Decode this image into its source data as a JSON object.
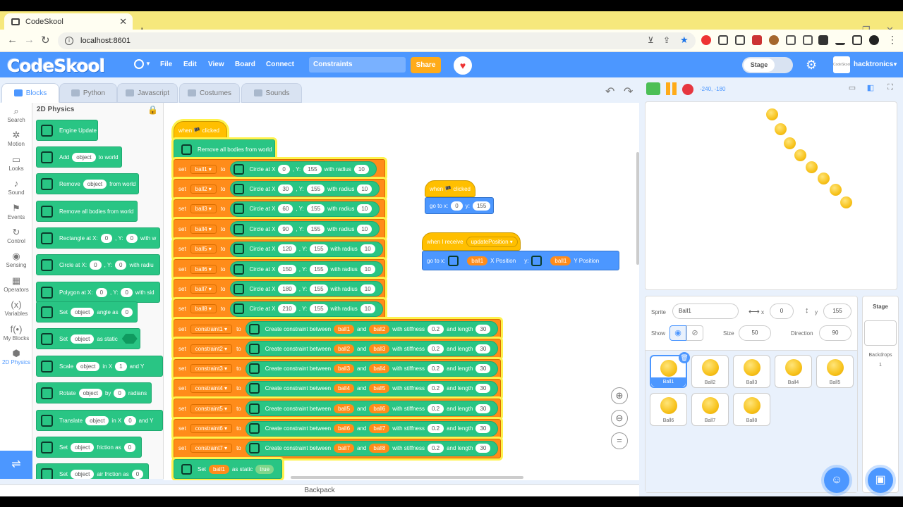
{
  "browser": {
    "tab_title": "CodeSkool",
    "url": "localhost:8601"
  },
  "app": {
    "logo": "CodeSkool",
    "menu": [
      "File",
      "Edit",
      "View",
      "Board",
      "Connect"
    ],
    "project_name": "Constraints",
    "share_label": "Share",
    "stage_toggle": "Stage",
    "username": "hacktronics",
    "avatar_text": "CodeSkool",
    "accent_color": "#4c97ff"
  },
  "editor_tabs": [
    "Blocks",
    "Python",
    "Javascript",
    "Costumes",
    "Sounds"
  ],
  "categories": [
    "Search",
    "Motion",
    "Looks",
    "Sound",
    "Events",
    "Control",
    "Sensing",
    "Operators",
    "Variables",
    "My Blocks",
    "2D Physics"
  ],
  "palette": {
    "title": "2D Physics",
    "blocks": [
      {
        "pre": "Engine Update",
        "p1": "",
        "mid": "",
        "p2": "",
        "post": ""
      },
      {
        "pre": "Add",
        "p1": "object",
        "mid": "to world",
        "p2": "",
        "post": ""
      },
      {
        "pre": "Remove",
        "p1": "object",
        "mid": "from world",
        "p2": "",
        "post": ""
      },
      {
        "pre": "Remove all bodies from world",
        "p1": "",
        "mid": "",
        "p2": "",
        "post": ""
      },
      {
        "pre": "Rectangle at X:",
        "p1": "0",
        "mid": ", Y:",
        "p2": "0",
        "post": "with w"
      },
      {
        "pre": "Circle at X:",
        "p1": "0",
        "mid": ", Y:",
        "p2": "0",
        "post": "with radiu"
      },
      {
        "pre": "Polygon at X:",
        "p1": "0",
        "mid": ", Y:",
        "p2": "0",
        "post": "with sid"
      },
      {
        "pre": "Set",
        "p1": "object",
        "mid": "angle as",
        "p2": "0",
        "post": ""
      },
      {
        "pre": "Set",
        "p1": "object",
        "mid": "as static",
        "p2": "",
        "post": ""
      },
      {
        "pre": "Scale",
        "p1": "object",
        "mid": "in X",
        "p2": "1",
        "post": "and Y"
      },
      {
        "pre": "Rotate",
        "p1": "object",
        "mid": "by",
        "p2": "0",
        "post": "radians"
      },
      {
        "pre": "Translate",
        "p1": "object",
        "mid": "in X",
        "p2": "0",
        "post": "and Y"
      },
      {
        "pre": "Set",
        "p1": "object",
        "mid": "friction as",
        "p2": "0",
        "post": ""
      },
      {
        "pre": "Set",
        "p1": "object",
        "mid": "air friction as",
        "p2": "0",
        "post": ""
      }
    ]
  },
  "script1": {
    "hat": "when 🏴 clicked",
    "remove_all": "Remove all bodies from world",
    "circles": [
      {
        "var": "ball1",
        "x": "0",
        "y": "155",
        "r": "10"
      },
      {
        "var": "ball2",
        "x": "30",
        "y": "155",
        "r": "10"
      },
      {
        "var": "ball3",
        "x": "60",
        "y": "155",
        "r": "10"
      },
      {
        "var": "ball4",
        "x": "90",
        "y": "155",
        "r": "10"
      },
      {
        "var": "ball5",
        "x": "120",
        "y": "155",
        "r": "10"
      },
      {
        "var": "ball6",
        "x": "150",
        "y": "155",
        "r": "10"
      },
      {
        "var": "ball7",
        "x": "180",
        "y": "155",
        "r": "10"
      },
      {
        "var": "ball8",
        "x": "210",
        "y": "155",
        "r": "10"
      }
    ],
    "constraints": [
      {
        "var": "constraint1",
        "a": "ball1",
        "b": "ball2",
        "stiff": "0.2",
        "len": "30"
      },
      {
        "var": "constraint2",
        "a": "ball2",
        "b": "ball3",
        "stiff": "0.2",
        "len": "30"
      },
      {
        "var": "constraint3",
        "a": "ball3",
        "b": "ball4",
        "stiff": "0.2",
        "len": "30"
      },
      {
        "var": "constraint4",
        "a": "ball4",
        "b": "ball5",
        "stiff": "0.2",
        "len": "30"
      },
      {
        "var": "constraint5",
        "a": "ball5",
        "b": "ball6",
        "stiff": "0.2",
        "len": "30"
      },
      {
        "var": "constraint6",
        "a": "ball6",
        "b": "ball7",
        "stiff": "0.2",
        "len": "30"
      },
      {
        "var": "constraint7",
        "a": "ball7",
        "b": "ball8",
        "stiff": "0.2",
        "len": "30"
      }
    ],
    "static": {
      "obj": "ball1",
      "val": "true"
    },
    "labels": {
      "set": "set",
      "to": "to",
      "circle": "Circle at X",
      "y": ", Y:",
      "radius": "with radius",
      "create": "Create constraint between",
      "and": "and",
      "stiffness": "with stiffness",
      "length": "and length",
      "setcap": "Set",
      "asstatic": "as static"
    }
  },
  "script2": {
    "hat": "when 🏴 clicked",
    "goto": "go to x:",
    "x": "0",
    "y": "155"
  },
  "script3": {
    "hat": "when I receive",
    "msg": "updatePosition",
    "goto": "go to x:",
    "xobj": "ball1",
    "xprop": "X Position",
    "ylbl": "y:",
    "yobj": "ball1",
    "yprop": "Y Position"
  },
  "stage": {
    "coords": "-240, -180"
  },
  "sprite_info": {
    "sprite_label": "Sprite",
    "sprite_name": "Ball1",
    "x_label": "x",
    "x": "0",
    "y_label": "y",
    "y": "155",
    "show_label": "Show",
    "size_label": "Size",
    "size": "50",
    "direction_label": "Direction",
    "direction": "90"
  },
  "sprites": [
    "Ball1",
    "Ball2",
    "Ball3",
    "Ball4",
    "Ball5",
    "Ball6",
    "Ball7",
    "Ball8"
  ],
  "stage_panel": {
    "title": "Stage",
    "backdrops_label": "Backdrops",
    "backdrops_count": "1"
  },
  "backpack": "Backpack"
}
